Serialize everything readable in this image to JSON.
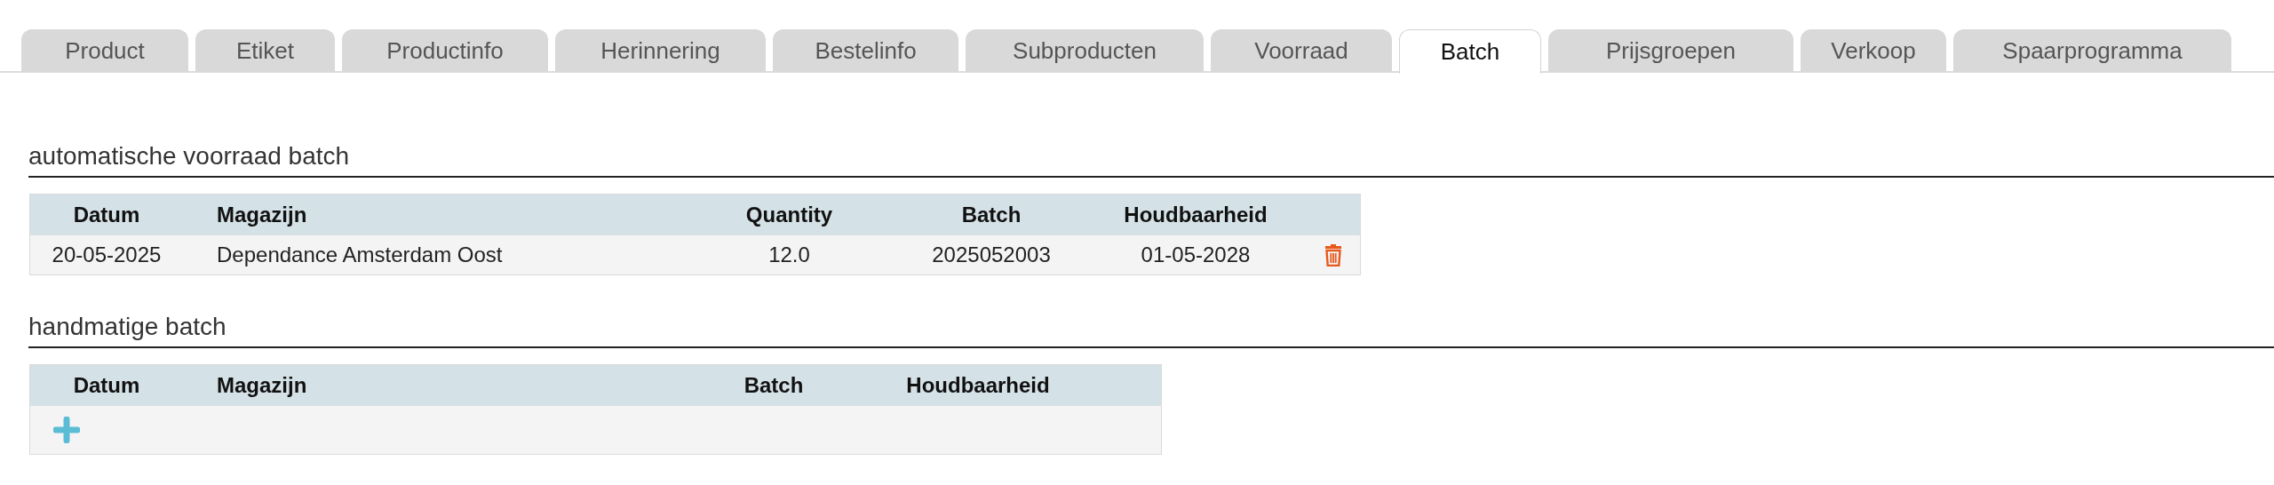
{
  "tabs": [
    {
      "label": "Product",
      "selected": false
    },
    {
      "label": "Etiket",
      "selected": false
    },
    {
      "label": "Productinfo",
      "selected": false
    },
    {
      "label": "Herinnering",
      "selected": false
    },
    {
      "label": "Bestelinfo",
      "selected": false
    },
    {
      "label": "Subproducten",
      "selected": false
    },
    {
      "label": "Voorraad",
      "selected": false
    },
    {
      "label": "Batch",
      "selected": true
    },
    {
      "label": "Prijsgroepen",
      "selected": false
    },
    {
      "label": "Verkoop",
      "selected": false
    },
    {
      "label": "Spaarprogramma",
      "selected": false
    }
  ],
  "automatic_batch": {
    "title": "automatische voorraad batch",
    "columns": [
      "Datum",
      "Magazijn",
      "Quantity",
      "Batch",
      "Houdbaarheid"
    ],
    "rows": [
      {
        "cells": [
          "20-05-2025",
          "Dependance Amsterdam Oost",
          "12.0",
          "2025052003",
          "01-05-2028"
        ]
      }
    ]
  },
  "manual_batch": {
    "title": "handmatige batch",
    "columns": [
      "Datum",
      "Magazijn",
      "Batch",
      "Houdbaarheid"
    ]
  }
}
